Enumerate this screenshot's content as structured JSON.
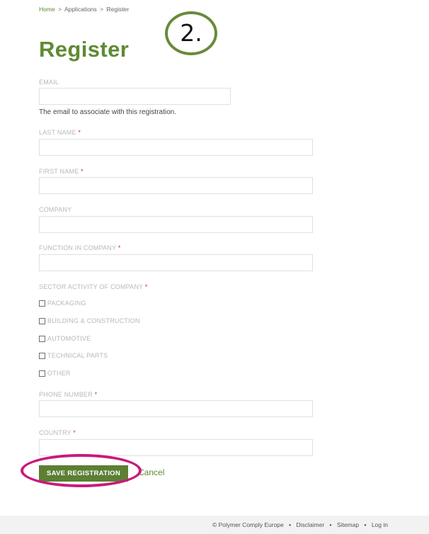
{
  "breadcrumb": {
    "home": "Home",
    "applications": "Applications",
    "current": "Register",
    "separator": ">"
  },
  "annotations": {
    "step_number": "2.",
    "annotation_colors": {
      "circle": "#6a8a3a",
      "ellipse": "#c9197b"
    }
  },
  "page": {
    "title": "Register",
    "accent_color": "#5e8a34"
  },
  "form": {
    "email": {
      "label": "EMAIL",
      "value": "",
      "help": "The email to associate with this registration."
    },
    "last_name": {
      "label": "LAST NAME",
      "required_mark": "*",
      "value": ""
    },
    "first_name": {
      "label": "FIRST NAME",
      "required_mark": "*",
      "value": ""
    },
    "company": {
      "label": "COMPANY",
      "value": ""
    },
    "function": {
      "label": "FUNCTION IN COMPANY",
      "required_mark": "*",
      "value": ""
    },
    "sector": {
      "label": "SECTOR ACTIVITY OF COMPANY",
      "required_mark": "*",
      "options": [
        {
          "label": "PACKAGING",
          "checked": false
        },
        {
          "label": "BUILDING & CONSTRUCTION",
          "checked": false
        },
        {
          "label": "AUTOMOTIVE",
          "checked": false
        },
        {
          "label": "TECHNICAL PARTS",
          "checked": false
        },
        {
          "label": "OTHER",
          "checked": false
        }
      ]
    },
    "phone": {
      "label": "PHONE NUMBER",
      "required_mark": "*",
      "value": ""
    },
    "country": {
      "label": "COUNTRY",
      "required_mark": "*",
      "value": ""
    },
    "save_label": "SAVE REGISTRATION",
    "cancel_label": "Cancel"
  },
  "footer": {
    "copyright": "© Polymer Comply Europe",
    "bullet": "•",
    "disclaimer": "Disclaimer",
    "sitemap": "Sitemap",
    "login": "Log in"
  }
}
